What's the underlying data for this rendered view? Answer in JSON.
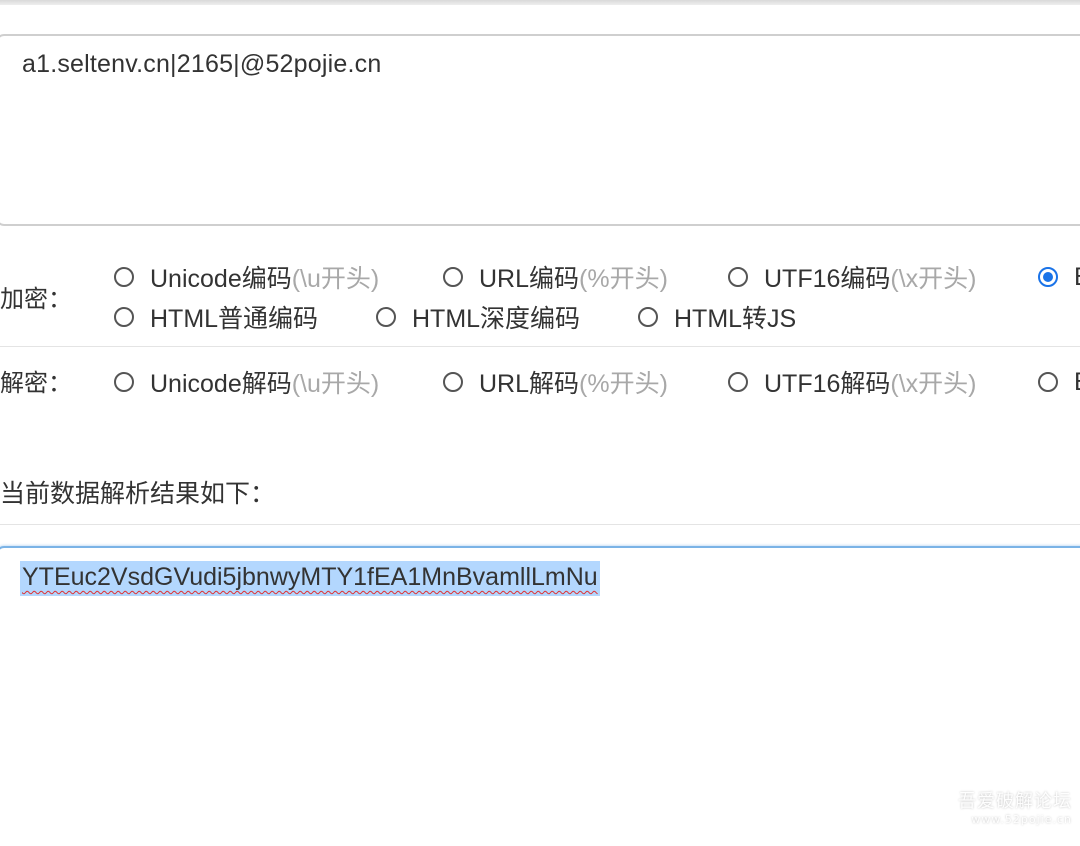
{
  "input": {
    "value": "a1.seltenv.cn|2165|@52pojie.cn"
  },
  "encrypt": {
    "label": "加密：",
    "options": [
      {
        "label": "Unicode编码",
        "hint": "(\\u开头)",
        "selected": false
      },
      {
        "label": "URL编码",
        "hint": "(%开头)",
        "selected": false
      },
      {
        "label": "UTF16编码",
        "hint": "(\\x开头)",
        "selected": false
      },
      {
        "label": "B",
        "hint": "",
        "selected": true
      },
      {
        "label": "HTML普通编码",
        "hint": "",
        "selected": false
      },
      {
        "label": "HTML深度编码",
        "hint": "",
        "selected": false
      },
      {
        "label": "HTML转JS",
        "hint": "",
        "selected": false
      }
    ]
  },
  "decrypt": {
    "label": "解密：",
    "options": [
      {
        "label": "Unicode解码",
        "hint": "(\\u开头)",
        "selected": false
      },
      {
        "label": "URL解码",
        "hint": "(%开头)",
        "selected": false
      },
      {
        "label": "UTF16解码",
        "hint": "(\\x开头)",
        "selected": false
      },
      {
        "label": "B",
        "hint": "",
        "selected": false
      }
    ]
  },
  "result": {
    "label": "当前数据解析结果如下：",
    "value": "YTEuc2VsdGVudi5jbnwyMTY1fEA1MnBvamllLmNu"
  },
  "watermark": {
    "title": "吾爱破解论坛",
    "url": "www.52pojie.cn"
  },
  "colors": {
    "accent": "#1a73e8",
    "selection": "#b3d7fe",
    "hint": "#a8a8a8"
  }
}
